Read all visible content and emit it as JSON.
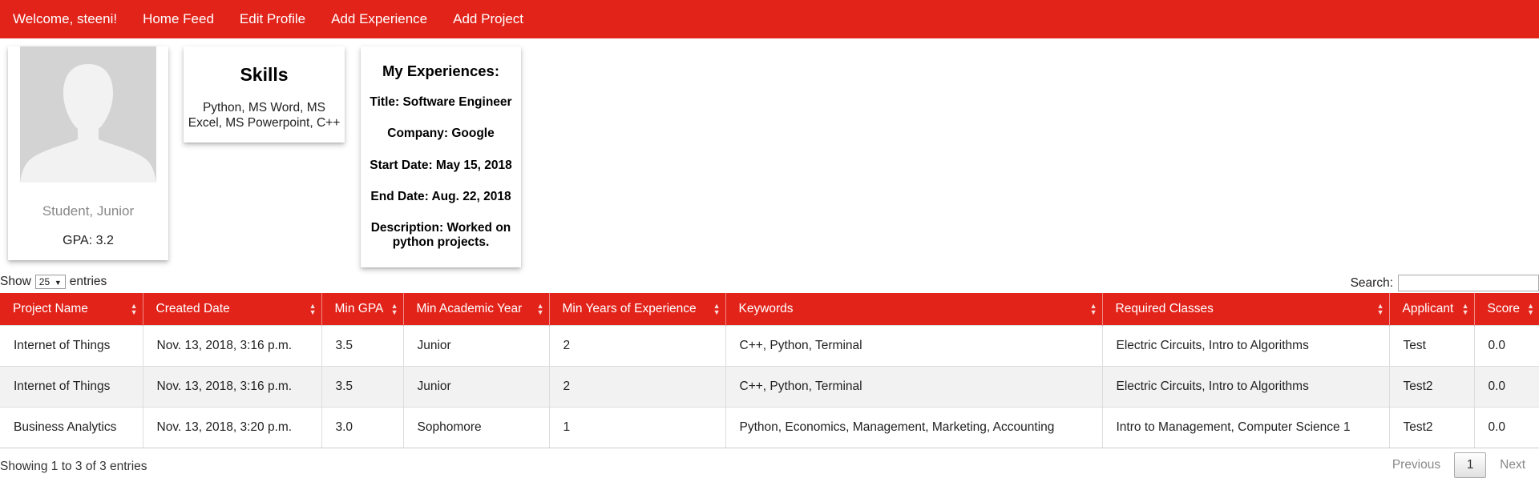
{
  "nav": {
    "welcome": "Welcome, steeni!",
    "home_feed": "Home Feed",
    "edit_profile": "Edit Profile",
    "add_experience": "Add Experience",
    "add_project": "Add Project"
  },
  "profile": {
    "role": "Student, Junior",
    "gpa": "GPA: 3.2"
  },
  "skills": {
    "title": "Skills",
    "text": "Python, MS Word, MS Excel, MS Powerpoint, C++"
  },
  "experience": {
    "title": "My Experiences:",
    "job_title": "Title: Software Engineer",
    "company": "Company: Google",
    "start_date": "Start Date: May 15, 2018",
    "end_date": "End Date: Aug. 22, 2018",
    "description": "Description: Worked on python projects."
  },
  "table_controls": {
    "show_label": "Show",
    "entries_label": "entries",
    "page_length": "25",
    "search_label": "Search:",
    "search_value": ""
  },
  "table": {
    "columns": [
      "Project Name",
      "Created Date",
      "Min GPA",
      "Min Academic Year",
      "Min Years of Experience",
      "Keywords",
      "Required Classes",
      "Applicant",
      "Score"
    ],
    "rows": [
      [
        "Internet of Things",
        "Nov. 13, 2018, 3:16 p.m.",
        "3.5",
        "Junior",
        "2",
        "C++, Python, Terminal",
        "Electric Circuits, Intro to Algorithms",
        "Test",
        "0.0"
      ],
      [
        "Internet of Things",
        "Nov. 13, 2018, 3:16 p.m.",
        "3.5",
        "Junior",
        "2",
        "C++, Python, Terminal",
        "Electric Circuits, Intro to Algorithms",
        "Test2",
        "0.0"
      ],
      [
        "Business Analytics",
        "Nov. 13, 2018, 3:20 p.m.",
        "3.0",
        "Sophomore",
        "1",
        "Python, Economics, Management, Marketing, Accounting",
        "Intro to Management, Computer Science 1",
        "Test2",
        "0.0"
      ]
    ]
  },
  "footer": {
    "info": "Showing 1 to 3 of 3 entries",
    "previous": "Previous",
    "current_page": "1",
    "next": "Next"
  },
  "colors": {
    "brand_red": "#e2231a",
    "avatar_bg": "#d3d3d3"
  }
}
